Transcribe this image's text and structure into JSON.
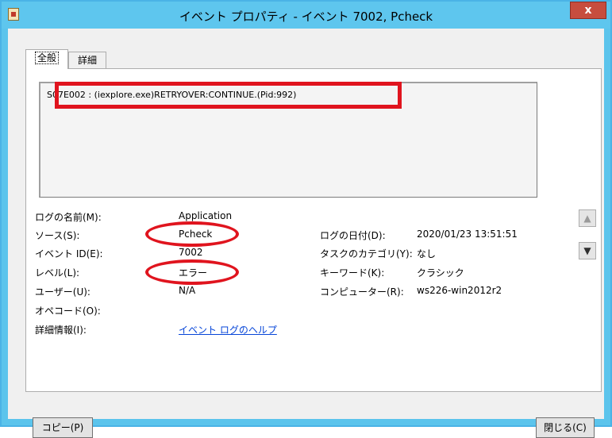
{
  "window": {
    "title": "イベント プロパティ - イベント 7002, Pcheck",
    "close_glyph": "x",
    "accent_color": "#5ec6ee",
    "highlight_color": "#e0141e"
  },
  "tabs": [
    {
      "label": "全般"
    },
    {
      "label": "詳細"
    }
  ],
  "description": "S07E002 : (iexplore.exe)RETRYOVER:CONTINUE.(Pid:992)",
  "fields": {
    "log_name_label": "ログの名前(M):",
    "log_name_value": "Application",
    "source_label": "ソース(S):",
    "source_value": "Pcheck",
    "event_id_label": "イベント ID(E):",
    "event_id_value": "7002",
    "level_label": "レベル(L):",
    "level_value": "エラー",
    "user_label": "ユーザー(U):",
    "user_value": "N/A",
    "opcode_label": "オペコード(O):",
    "details_label": "詳細情報(I):",
    "details_link": "イベント ログのヘルプ",
    "logged_label": "ログの日付(D):",
    "logged_value": "2020/01/23 13:51:51",
    "task_label": "タスクのカテゴリ(Y):",
    "task_value": "なし",
    "keywords_label": "キーワード(K):",
    "keywords_value": "クラシック",
    "computer_label": "コンピューター(R):",
    "computer_value": "ws226-win2012r2"
  },
  "nav": {
    "up_icon": "arrow-up-icon",
    "down_icon": "arrow-down-icon",
    "up_glyph": "▲",
    "down_glyph": "▼"
  },
  "buttons": {
    "copy": "コピー(P)",
    "close": "閉じる(C)"
  }
}
